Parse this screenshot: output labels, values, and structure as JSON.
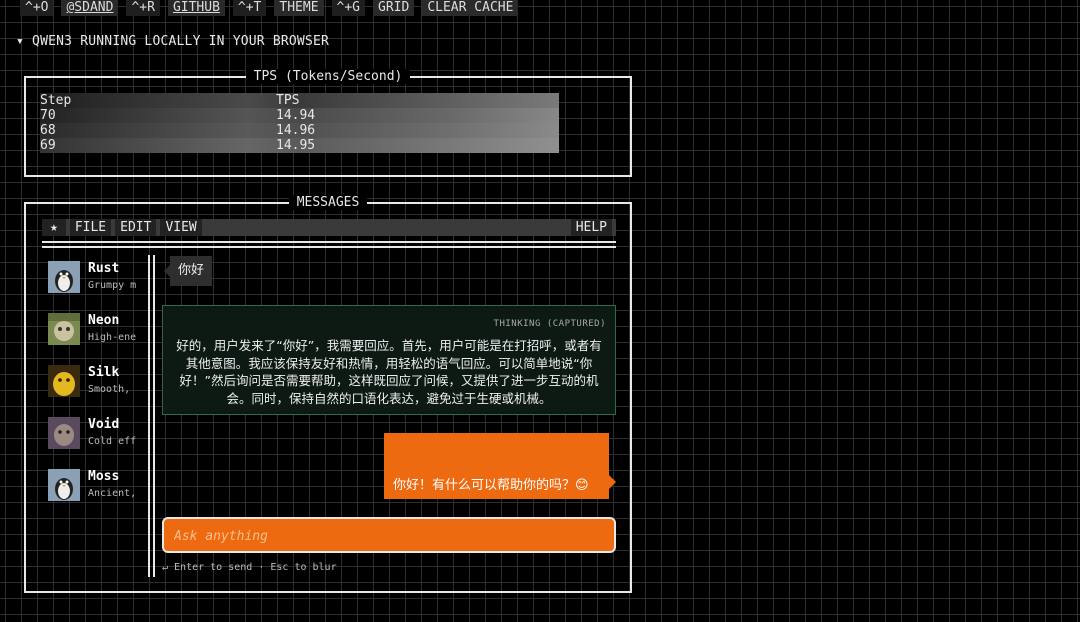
{
  "topbar": [
    {
      "label": "^+O",
      "kind": "key"
    },
    {
      "label": "@SDAND",
      "kind": "link"
    },
    {
      "label": "^+R",
      "kind": "key"
    },
    {
      "label": "GITHUB",
      "kind": "link"
    },
    {
      "label": "^+T",
      "kind": "key"
    },
    {
      "label": "THEME",
      "kind": "btn"
    },
    {
      "label": "^+G",
      "kind": "key"
    },
    {
      "label": "GRID",
      "kind": "btn"
    },
    {
      "label": "CLEAR CACHE",
      "kind": "btn"
    }
  ],
  "section_title": "▾ QWEN3 RUNNING LOCALLY IN YOUR BROWSER",
  "tps": {
    "title": "TPS (Tokens/Second)",
    "headers": [
      "Step",
      "TPS"
    ],
    "rows": [
      [
        "70",
        "14.94"
      ],
      [
        "68",
        "14.96"
      ],
      [
        "69",
        "14.95"
      ]
    ]
  },
  "messages": {
    "title": "MESSAGES",
    "menu": {
      "star": "★",
      "file": "FILE",
      "edit": "EDIT",
      "view": "VIEW",
      "help": "HELP"
    },
    "contacts": [
      {
        "name": "Rust",
        "desc": "Grumpy m",
        "avatar_color": "#6a7f93"
      },
      {
        "name": "Neon",
        "desc": "High-ene",
        "avatar_color": "#7a8a50"
      },
      {
        "name": "Silk",
        "desc": "Smooth,",
        "avatar_color": "#c9a020"
      },
      {
        "name": "Void",
        "desc": "Cold eff",
        "avatar_color": "#6a5a70"
      },
      {
        "name": "Moss",
        "desc": "Ancient,",
        "avatar_color": "#6f8090"
      }
    ],
    "user_message": "你好",
    "thinking": {
      "label": "THINKING (CAPTURED)",
      "text": "好的，用户发来了“你好”，我需要回应。首先，用户可能是在打招呼，或者有其他意图。我应该保持友好和热情，用轻松的语气回应。可以简单地说“你好！”然后询问是否需要帮助，这样既回应了问候，又提供了进一步互动的机会。同时，保持自然的口语化表达，避免过于生硬或机械。"
    },
    "assistant_message": "你好！有什么可以帮助你的吗？😊",
    "input": {
      "placeholder": "Ask anything",
      "value": ""
    },
    "hint": "↵ Enter to send · Esc to blur"
  },
  "colors": {
    "accent": "#ee6a10",
    "thinking_border": "#2f6a4a",
    "grid": "#2e2e2e"
  }
}
